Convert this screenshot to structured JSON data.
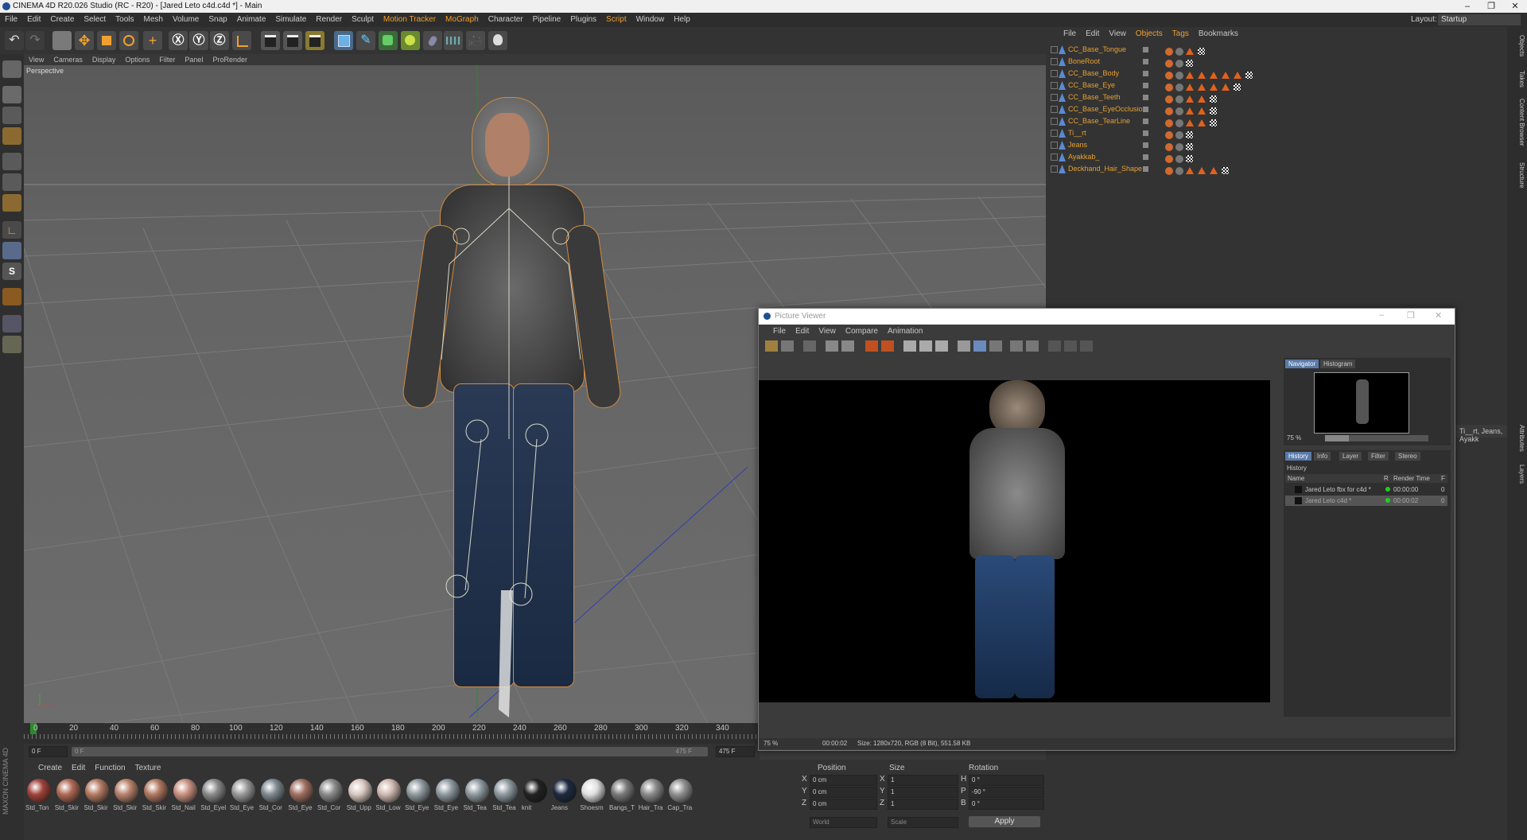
{
  "window": {
    "title": "CINEMA 4D R20.026 Studio (RC - R20) - [Jared Leto c4d.c4d *] - Main",
    "minimize": "–",
    "maximize": "❐",
    "close": "✕"
  },
  "menu": [
    "File",
    "Edit",
    "Create",
    "Select",
    "Tools",
    "Mesh",
    "Volume",
    "Snap",
    "Animate",
    "Simulate",
    "Render",
    "Sculpt",
    "Motion Tracker",
    "MoGraph",
    "Character",
    "Pipeline",
    "Plugins",
    "Script",
    "Window",
    "Help"
  ],
  "layout": {
    "label": "Layout:",
    "value": "Startup"
  },
  "viewport": {
    "menu": [
      "View",
      "Cameras",
      "Display",
      "Options",
      "Filter",
      "Panel",
      "ProRender"
    ],
    "label": "Perspective"
  },
  "timeline": {
    "ticks": [
      "0",
      "20",
      "40",
      "60",
      "80",
      "100",
      "120",
      "140",
      "160",
      "180",
      "200",
      "220",
      "240",
      "260",
      "280",
      "300",
      "320",
      "340"
    ],
    "start": "0 F",
    "current": "0 F",
    "end": "475 F",
    "end2": "475 F"
  },
  "materials": {
    "menu": [
      "Create",
      "Edit",
      "Function",
      "Texture"
    ],
    "items": [
      {
        "label": "Std_Ton",
        "color": "#a0433a"
      },
      {
        "label": "Std_Skir",
        "color": "#b06a55"
      },
      {
        "label": "Std_Skir",
        "color": "#b47a62"
      },
      {
        "label": "Std_Skir",
        "color": "#b8826c"
      },
      {
        "label": "Std_Skir",
        "color": "#b07860"
      },
      {
        "label": "Std_Nail",
        "color": "#c89080"
      },
      {
        "label": "Std_Eyel",
        "color": "#8a8a8a"
      },
      {
        "label": "Std_Eye",
        "color": "#9a9a9a"
      },
      {
        "label": "Std_Cor",
        "color": "#7f8a90"
      },
      {
        "label": "Std_Eye",
        "color": "#a07060"
      },
      {
        "label": "Std_Cor",
        "color": "#8b8b8b"
      },
      {
        "label": "Std_Upp",
        "color": "#d8c8c0"
      },
      {
        "label": "Std_Low",
        "color": "#d0b8b0"
      },
      {
        "label": "Std_Eye",
        "color": "#909aa0"
      },
      {
        "label": "Std_Eye",
        "color": "#8f9aa0"
      },
      {
        "label": "Std_Tea",
        "color": "#909aa0"
      },
      {
        "label": "Std_Tea",
        "color": "#8e9aa0"
      },
      {
        "label": "knit",
        "color": "#222222"
      },
      {
        "label": "Jeans",
        "color": "#1c2a40"
      },
      {
        "label": "Shoesm",
        "color": "#e0e0e0"
      },
      {
        "label": "Bangs_T",
        "color": "#7a7a7a"
      },
      {
        "label": "Hair_Tra",
        "color": "#8a8a8a"
      },
      {
        "label": "Cap_Tra",
        "color": "#909090"
      }
    ]
  },
  "coords": {
    "headers": [
      "Position",
      "Size",
      "Rotation"
    ],
    "rows": [
      {
        "axis": "X",
        "pos": "0 cm",
        "sizeAxis": "X",
        "size": "1",
        "rotAxis": "H",
        "rot": "0 °"
      },
      {
        "axis": "Y",
        "pos": "0 cm",
        "sizeAxis": "Y",
        "size": "1",
        "rotAxis": "P",
        "rot": "-90 °"
      },
      {
        "axis": "Z",
        "pos": "0 cm",
        "sizeAxis": "Z",
        "size": "1",
        "rotAxis": "B",
        "rot": "0 °"
      }
    ],
    "mode1": "World",
    "mode2": "Scale",
    "apply": "Apply"
  },
  "objects": {
    "menu": [
      "File",
      "Edit",
      "View",
      "Objects",
      "Tags",
      "Bookmarks"
    ],
    "rows": [
      {
        "name": "CC_Base_Tongue",
        "tris": 1
      },
      {
        "name": "BoneRoot",
        "tris": 0
      },
      {
        "name": "CC_Base_Body",
        "tris": 5
      },
      {
        "name": "CC_Base_Eye",
        "tris": 4
      },
      {
        "name": "CC_Base_Teeth",
        "tris": 2
      },
      {
        "name": "CC_Base_EyeOcclusion",
        "tris": 2
      },
      {
        "name": "CC_Base_TearLine",
        "tris": 2
      },
      {
        "name": "Ti__rt",
        "tris": 0
      },
      {
        "name": "Jeans",
        "tris": 0
      },
      {
        "name": "Ayakkab_",
        "tris": 0
      },
      {
        "name": "Deckhand_Hair_Shape",
        "tris": 3
      }
    ]
  },
  "attributes": {
    "selection": "Ti__rt, Jeans, Ayakk"
  },
  "sidetabs": [
    "Objects",
    "Takes",
    "Content Browser",
    "Structure"
  ],
  "sidetabs2": [
    "Attributes",
    "Layers"
  ],
  "picture_viewer": {
    "title": "Picture Viewer",
    "menu": [
      "File",
      "Edit",
      "View",
      "Compare",
      "Animation"
    ],
    "tabs": [
      "Navigator",
      "Histogram"
    ],
    "zoom": "75 %",
    "history_tabs": [
      "History",
      "Info",
      "Layer",
      "Filter",
      "Stereo"
    ],
    "history_label": "History",
    "columns": [
      "Name",
      "R",
      "Render Time",
      "F"
    ],
    "history": [
      {
        "name": "Jared Leto fbx for c4d *",
        "time": "00:00:00",
        "f": "0"
      },
      {
        "name": "Jared Leto c4d *",
        "time": "00:00:02",
        "f": "0"
      }
    ],
    "status_zoom": "75 %",
    "status_time": "00:00:02",
    "status_info": "Size: 1280x720, RGB (8 Bit), 551.58 KB"
  },
  "logo": {
    "line1": "MAXON",
    "line2": "CINEMA 4D"
  }
}
